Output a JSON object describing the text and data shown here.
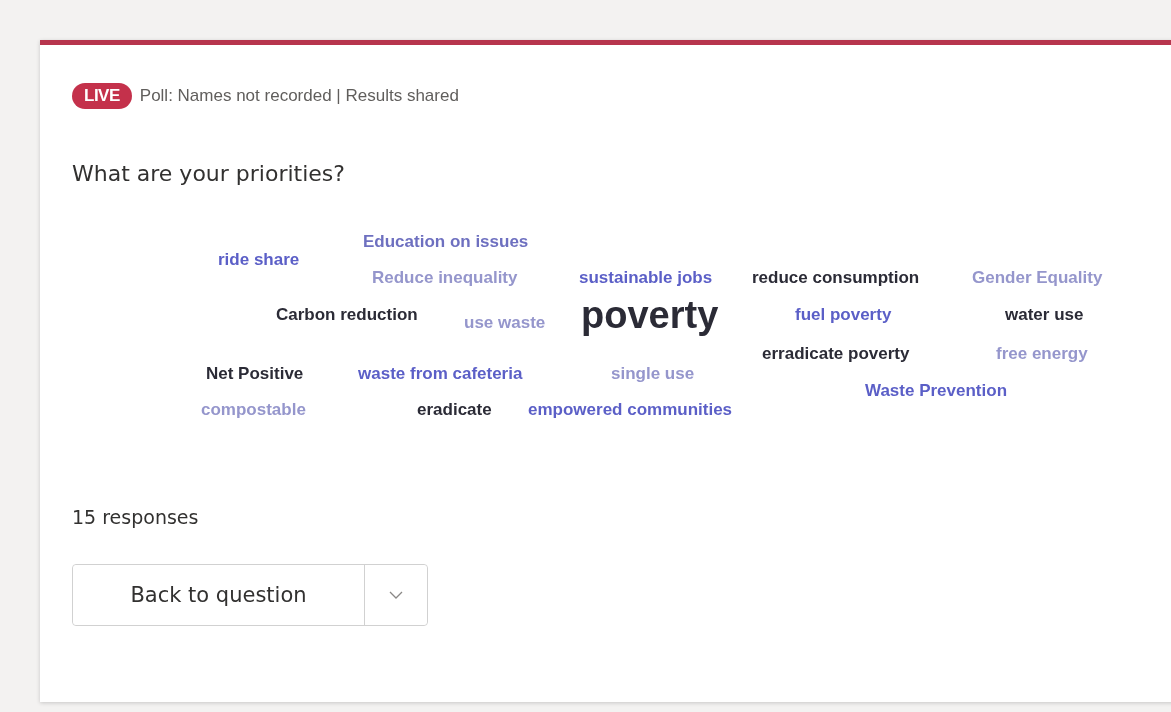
{
  "status": {
    "badge": "LIVE",
    "info": "Poll: Names not recorded | Results shared"
  },
  "question": "What are your priorities?",
  "word_cloud": [
    {
      "text": "ride share",
      "color": "#5b5fc7",
      "kind": "normal"
    },
    {
      "text": "Education on issues",
      "color": "#6e70c0",
      "kind": "normal"
    },
    {
      "text": "Reduce inequality",
      "color": "#9596cc",
      "kind": "normal"
    },
    {
      "text": "sustainable jobs",
      "color": "#5b5fc7",
      "kind": "normal"
    },
    {
      "text": "reduce consumption",
      "color": "#2b2b36",
      "kind": "normal"
    },
    {
      "text": "Gender Equality",
      "color": "#9596cc",
      "kind": "normal"
    },
    {
      "text": "Carbon reduction",
      "color": "#2b2b36",
      "kind": "normal"
    },
    {
      "text": "use waste",
      "color": "#9596cc",
      "kind": "normal"
    },
    {
      "text": "poverty",
      "color": "#2b2b36",
      "kind": "large"
    },
    {
      "text": "fuel poverty",
      "color": "#5b5fc7",
      "kind": "normal"
    },
    {
      "text": "water use",
      "color": "#2b2b36",
      "kind": "normal"
    },
    {
      "text": "erradicate poverty",
      "color": "#2b2b36",
      "kind": "normal"
    },
    {
      "text": "free energy",
      "color": "#9596cc",
      "kind": "normal"
    },
    {
      "text": "Net Positive",
      "color": "#2b2b36",
      "kind": "normal"
    },
    {
      "text": "waste from cafeteria",
      "color": "#5b5fc7",
      "kind": "normal"
    },
    {
      "text": "single use",
      "color": "#9596cc",
      "kind": "normal"
    },
    {
      "text": "Waste Prevention",
      "color": "#5b5fc7",
      "kind": "normal"
    },
    {
      "text": "compostable",
      "color": "#9596cc",
      "kind": "normal"
    },
    {
      "text": "eradicate",
      "color": "#2b2b36",
      "kind": "normal"
    },
    {
      "text": "empowered communities",
      "color": "#5b5fc7",
      "kind": "normal"
    }
  ],
  "responses": "15 responses",
  "button": {
    "label": "Back to question"
  }
}
